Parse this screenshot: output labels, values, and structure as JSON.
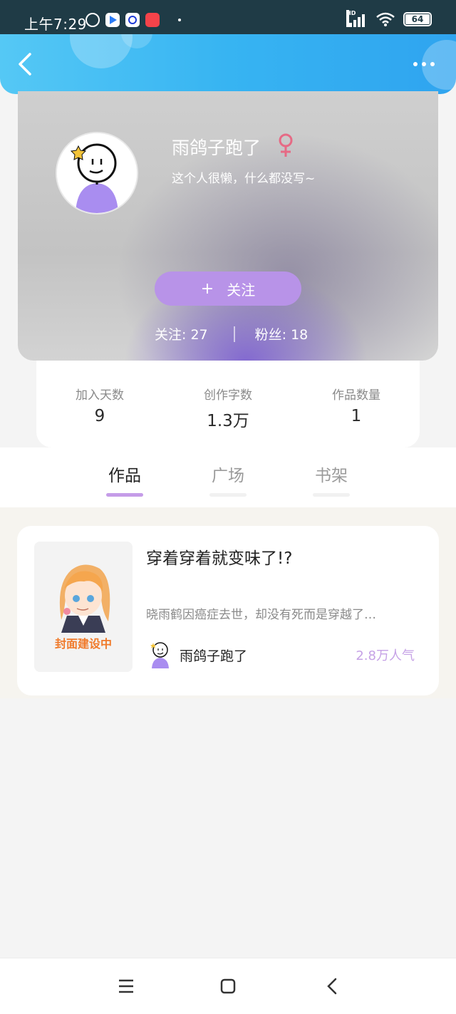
{
  "status_bar": {
    "time": "上午7:29",
    "network": "HD",
    "battery": "64"
  },
  "header": {
    "back_icon": "chevron-left-icon",
    "more_icon": "more-dots-icon"
  },
  "profile": {
    "username": "雨鸽子跑了",
    "gender": "♀",
    "bio": "这个人很懒，什么都没写~",
    "follow_button": "关注",
    "follow_plus": "+",
    "following": "关注: 27",
    "followers": "粉丝: 18"
  },
  "stats": [
    {
      "label": "加入天数",
      "value": "9"
    },
    {
      "label": "创作字数",
      "value": "1.3万"
    },
    {
      "label": "作品数量",
      "value": "1"
    }
  ],
  "tabs": [
    {
      "label": "作品",
      "active": true
    },
    {
      "label": "广场",
      "active": false
    },
    {
      "label": "书架",
      "active": false
    }
  ],
  "works": [
    {
      "title": "穿着穿着就变味了!?",
      "cover_text": "封面建设中",
      "description": "晓雨鹤因癌症去世，却没有死而是穿越了…",
      "author": "雨鸽子跑了",
      "popularity": "2.8万人气"
    }
  ],
  "colors": {
    "header_gradient_start": "#55c8f5",
    "header_gradient_end": "#2fa4ef",
    "accent_purple": "#b893e8",
    "gender_pink": "#e66a85",
    "popularity_purple": "#c6a2e6"
  }
}
